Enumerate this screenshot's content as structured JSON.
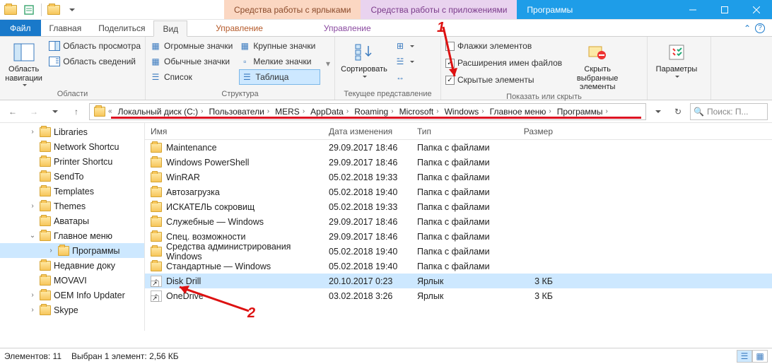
{
  "window": {
    "title": "Программы"
  },
  "context_tabs": {
    "shortcuts": "Средства работы с ярлыками",
    "apps": "Средства работы с приложениями"
  },
  "tabs": {
    "file": "Файл",
    "home": "Главная",
    "share": "Поделиться",
    "view": "Вид",
    "manage1": "Управление",
    "manage2": "Управление"
  },
  "ribbon": {
    "nav_pane": "Область навигации",
    "preview_pane": "Область просмотра",
    "details_pane": "Область сведений",
    "group_panes": "Области",
    "huge_icons": "Огромные значки",
    "large_icons": "Крупные значки",
    "medium_icons": "Обычные значки",
    "small_icons": "Мелкие значки",
    "list": "Список",
    "table": "Таблица",
    "group_layout": "Структура",
    "sort": "Сортировать",
    "group_current": "Текущее представление",
    "item_checkboxes": "Флажки элементов",
    "file_ext": "Расширения имен файлов",
    "hidden_items": "Скрытые элементы",
    "hide_selected": "Скрыть выбранные элементы",
    "group_showhide": "Показать или скрыть",
    "options": "Параметры"
  },
  "breadcrumbs": [
    "Локальный диск (C:)",
    "Пользователи",
    "MERS",
    "AppData",
    "Roaming",
    "Microsoft",
    "Windows",
    "Главное меню",
    "Программы"
  ],
  "search": {
    "placeholder": "Поиск: П..."
  },
  "tree": [
    {
      "depth": 2,
      "exp": ">",
      "label": "Libraries"
    },
    {
      "depth": 2,
      "exp": "",
      "label": "Network Shortcu"
    },
    {
      "depth": 2,
      "exp": "",
      "label": "Printer Shortcu"
    },
    {
      "depth": 2,
      "exp": "",
      "label": "SendTo"
    },
    {
      "depth": 2,
      "exp": "",
      "label": "Templates"
    },
    {
      "depth": 2,
      "exp": ">",
      "label": "Themes"
    },
    {
      "depth": 2,
      "exp": "",
      "label": "Аватары"
    },
    {
      "depth": 2,
      "exp": "v",
      "label": "Главное меню"
    },
    {
      "depth": 3,
      "exp": ">",
      "label": "Программы",
      "sel": true
    },
    {
      "depth": 2,
      "exp": "",
      "label": "Недавние доку"
    },
    {
      "depth": 2,
      "exp": "",
      "label": "MOVAVI"
    },
    {
      "depth": 2,
      "exp": ">",
      "label": "OEM Info Updater"
    },
    {
      "depth": 2,
      "exp": ">",
      "label": "Skype"
    }
  ],
  "columns": {
    "name": "Имя",
    "date": "Дата изменения",
    "type": "Тип",
    "size": "Размер"
  },
  "rows": [
    {
      "icon": "folder",
      "name": "Maintenance",
      "date": "29.09.2017 18:46",
      "type": "Папка с файлами",
      "size": ""
    },
    {
      "icon": "folder",
      "name": "Windows PowerShell",
      "date": "29.09.2017 18:46",
      "type": "Папка с файлами",
      "size": ""
    },
    {
      "icon": "folder",
      "name": "WinRAR",
      "date": "05.02.2018 19:33",
      "type": "Папка с файлами",
      "size": ""
    },
    {
      "icon": "folder",
      "name": "Автозагрузка",
      "date": "05.02.2018 19:40",
      "type": "Папка с файлами",
      "size": ""
    },
    {
      "icon": "folder",
      "name": "ИСКАТЕЛЬ сокровищ",
      "date": "05.02.2018 19:33",
      "type": "Папка с файлами",
      "size": ""
    },
    {
      "icon": "folder",
      "name": "Служебные — Windows",
      "date": "29.09.2017 18:46",
      "type": "Папка с файлами",
      "size": ""
    },
    {
      "icon": "folder",
      "name": "Спец. возможности",
      "date": "29.09.2017 18:46",
      "type": "Папка с файлами",
      "size": ""
    },
    {
      "icon": "folder",
      "name": "Средства администрирования Windows",
      "date": "05.02.2018 19:40",
      "type": "Папка с файлами",
      "size": ""
    },
    {
      "icon": "folder",
      "name": "Стандартные — Windows",
      "date": "05.02.2018 19:40",
      "type": "Папка с файлами",
      "size": ""
    },
    {
      "icon": "shortcut",
      "name": "Disk Drill",
      "date": "20.10.2017 0:23",
      "type": "Ярлык",
      "size": "3 КБ",
      "sel": true
    },
    {
      "icon": "shortcut",
      "name": "OneDrive",
      "date": "03.02.2018 3:26",
      "type": "Ярлык",
      "size": "3 КБ"
    }
  ],
  "status": {
    "count": "Элементов: 11",
    "selection": "Выбран 1 элемент: 2,56 КБ"
  },
  "annotations": {
    "one": "1",
    "two": "2"
  }
}
